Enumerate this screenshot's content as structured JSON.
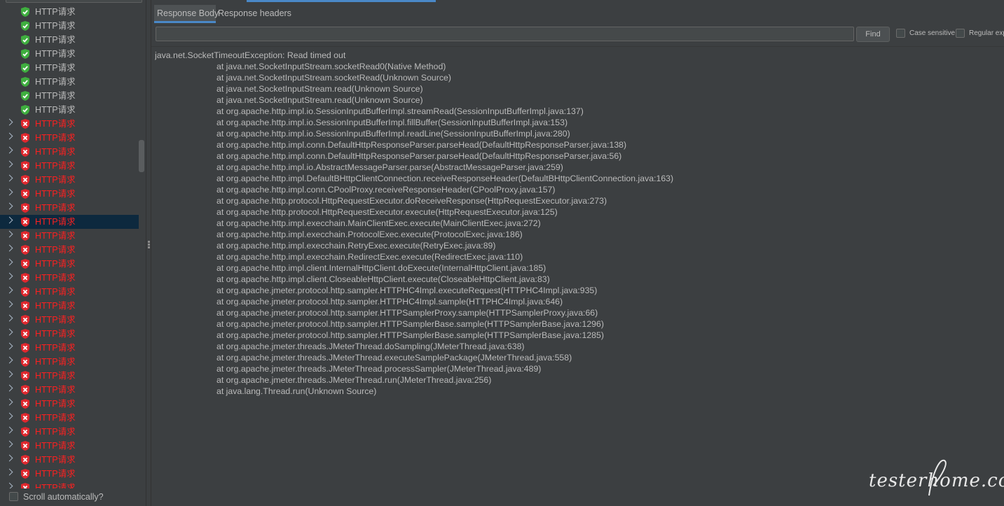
{
  "tree": {
    "items": [
      {
        "label": "HTTP请求",
        "status": "success",
        "expandable": false,
        "selected": false
      },
      {
        "label": "HTTP请求",
        "status": "success",
        "expandable": false,
        "selected": false
      },
      {
        "label": "HTTP请求",
        "status": "success",
        "expandable": false,
        "selected": false
      },
      {
        "label": "HTTP请求",
        "status": "success",
        "expandable": false,
        "selected": false
      },
      {
        "label": "HTTP请求",
        "status": "success",
        "expandable": false,
        "selected": false
      },
      {
        "label": "HTTP请求",
        "status": "success",
        "expandable": false,
        "selected": false
      },
      {
        "label": "HTTP请求",
        "status": "success",
        "expandable": false,
        "selected": false
      },
      {
        "label": "HTTP请求",
        "status": "success",
        "expandable": false,
        "selected": false
      },
      {
        "label": "HTTP请求",
        "status": "error",
        "expandable": true,
        "selected": false
      },
      {
        "label": "HTTP请求",
        "status": "error",
        "expandable": true,
        "selected": false
      },
      {
        "label": "HTTP请求",
        "status": "error",
        "expandable": true,
        "selected": false
      },
      {
        "label": "HTTP请求",
        "status": "error",
        "expandable": true,
        "selected": false
      },
      {
        "label": "HTTP请求",
        "status": "error",
        "expandable": true,
        "selected": false
      },
      {
        "label": "HTTP请求",
        "status": "error",
        "expandable": true,
        "selected": false
      },
      {
        "label": "HTTP请求",
        "status": "error",
        "expandable": true,
        "selected": false
      },
      {
        "label": "HTTP请求",
        "status": "error",
        "expandable": true,
        "selected": true
      },
      {
        "label": "HTTP请求",
        "status": "error",
        "expandable": true,
        "selected": false
      },
      {
        "label": "HTTP请求",
        "status": "error",
        "expandable": true,
        "selected": false
      },
      {
        "label": "HTTP请求",
        "status": "error",
        "expandable": true,
        "selected": false
      },
      {
        "label": "HTTP请求",
        "status": "error",
        "expandable": true,
        "selected": false
      },
      {
        "label": "HTTP请求",
        "status": "error",
        "expandable": true,
        "selected": false
      },
      {
        "label": "HTTP请求",
        "status": "error",
        "expandable": true,
        "selected": false
      },
      {
        "label": "HTTP请求",
        "status": "error",
        "expandable": true,
        "selected": false
      },
      {
        "label": "HTTP请求",
        "status": "error",
        "expandable": true,
        "selected": false
      },
      {
        "label": "HTTP请求",
        "status": "error",
        "expandable": true,
        "selected": false
      },
      {
        "label": "HTTP请求",
        "status": "error",
        "expandable": true,
        "selected": false
      },
      {
        "label": "HTTP请求",
        "status": "error",
        "expandable": true,
        "selected": false
      },
      {
        "label": "HTTP请求",
        "status": "error",
        "expandable": true,
        "selected": false
      },
      {
        "label": "HTTP请求",
        "status": "error",
        "expandable": true,
        "selected": false
      },
      {
        "label": "HTTP请求",
        "status": "error",
        "expandable": true,
        "selected": false
      },
      {
        "label": "HTTP请求",
        "status": "error",
        "expandable": true,
        "selected": false
      },
      {
        "label": "HTTP请求",
        "status": "error",
        "expandable": true,
        "selected": false
      },
      {
        "label": "HTTP请求",
        "status": "error",
        "expandable": true,
        "selected": false
      },
      {
        "label": "HTTP请求",
        "status": "error",
        "expandable": true,
        "selected": false
      },
      {
        "label": "HTTP请求",
        "status": "error",
        "expandable": true,
        "selected": false
      }
    ],
    "icons": {
      "success": "shield-check-icon",
      "error": "shield-x-icon",
      "expand": "chevron-right-icon"
    },
    "scroll_automatically_label": "Scroll automatically?"
  },
  "tabs": [
    {
      "label": "Response Body",
      "active": true
    },
    {
      "label": "Response headers",
      "active": false
    }
  ],
  "search": {
    "value": "",
    "find_label": "Find",
    "case_sensitive_label": "Case sensitive",
    "regex_label": "Regular exp"
  },
  "response": {
    "exception": "java.net.SocketTimeoutException: Read timed out",
    "trace": [
      "at java.net.SocketInputStream.socketRead0(Native Method)",
      "at java.net.SocketInputStream.socketRead(Unknown Source)",
      "at java.net.SocketInputStream.read(Unknown Source)",
      "at java.net.SocketInputStream.read(Unknown Source)",
      "at org.apache.http.impl.io.SessionInputBufferImpl.streamRead(SessionInputBufferImpl.java:137)",
      "at org.apache.http.impl.io.SessionInputBufferImpl.fillBuffer(SessionInputBufferImpl.java:153)",
      "at org.apache.http.impl.io.SessionInputBufferImpl.readLine(SessionInputBufferImpl.java:280)",
      "at org.apache.http.impl.conn.DefaultHttpResponseParser.parseHead(DefaultHttpResponseParser.java:138)",
      "at org.apache.http.impl.conn.DefaultHttpResponseParser.parseHead(DefaultHttpResponseParser.java:56)",
      "at org.apache.http.impl.io.AbstractMessageParser.parse(AbstractMessageParser.java:259)",
      "at org.apache.http.impl.DefaultBHttpClientConnection.receiveResponseHeader(DefaultBHttpClientConnection.java:163)",
      "at org.apache.http.impl.conn.CPoolProxy.receiveResponseHeader(CPoolProxy.java:157)",
      "at org.apache.http.protocol.HttpRequestExecutor.doReceiveResponse(HttpRequestExecutor.java:273)",
      "at org.apache.http.protocol.HttpRequestExecutor.execute(HttpRequestExecutor.java:125)",
      "at org.apache.http.impl.execchain.MainClientExec.execute(MainClientExec.java:272)",
      "at org.apache.http.impl.execchain.ProtocolExec.execute(ProtocolExec.java:186)",
      "at org.apache.http.impl.execchain.RetryExec.execute(RetryExec.java:89)",
      "at org.apache.http.impl.execchain.RedirectExec.execute(RedirectExec.java:110)",
      "at org.apache.http.impl.client.InternalHttpClient.doExecute(InternalHttpClient.java:185)",
      "at org.apache.http.impl.client.CloseableHttpClient.execute(CloseableHttpClient.java:83)",
      "at org.apache.jmeter.protocol.http.sampler.HTTPHC4Impl.executeRequest(HTTPHC4Impl.java:935)",
      "at org.apache.jmeter.protocol.http.sampler.HTTPHC4Impl.sample(HTTPHC4Impl.java:646)",
      "at org.apache.jmeter.protocol.http.sampler.HTTPSamplerProxy.sample(HTTPSamplerProxy.java:66)",
      "at org.apache.jmeter.protocol.http.sampler.HTTPSamplerBase.sample(HTTPSamplerBase.java:1296)",
      "at org.apache.jmeter.protocol.http.sampler.HTTPSamplerBase.sample(HTTPSamplerBase.java:1285)",
      "at org.apache.jmeter.threads.JMeterThread.doSampling(JMeterThread.java:638)",
      "at org.apache.jmeter.threads.JMeterThread.executeSamplePackage(JMeterThread.java:558)",
      "at org.apache.jmeter.threads.JMeterThread.processSampler(JMeterThread.java:489)",
      "at org.apache.jmeter.threads.JMeterThread.run(JMeterThread.java:256)",
      "at java.lang.Thread.run(Unknown Source)"
    ]
  },
  "watermark": "testerhome.com",
  "colors": {
    "background": "#3c3f41",
    "text": "#bbbbbb",
    "error_text": "#ff2020",
    "success_icon": "#3fae3f",
    "error_icon": "#e0282e",
    "selection": "#0d293e",
    "accent": "#4a88c7"
  }
}
